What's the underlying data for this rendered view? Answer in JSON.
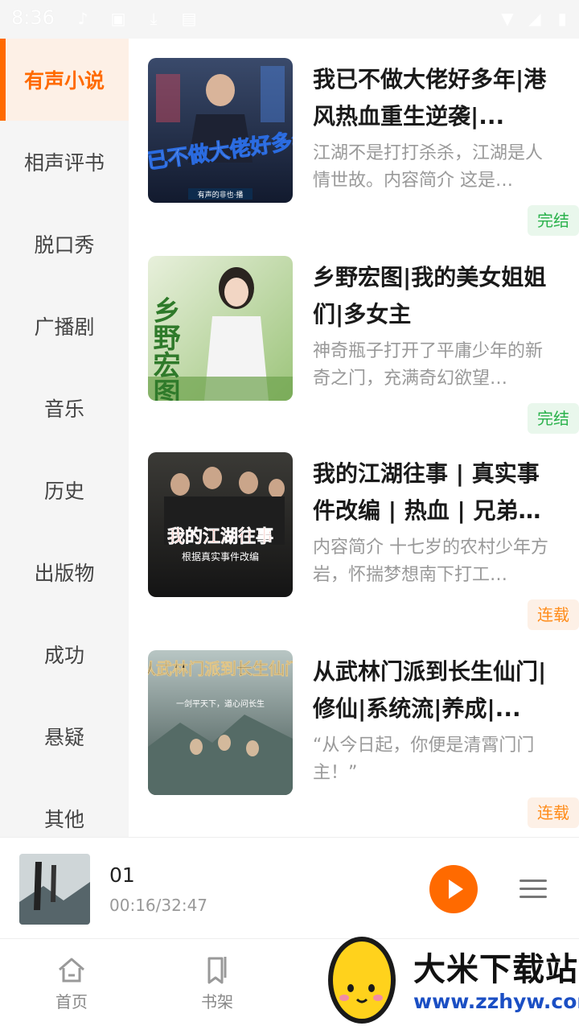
{
  "status_bar": {
    "time": "8:36"
  },
  "sidebar": {
    "categories": [
      "有声小说",
      "相声评书",
      "脱口秀",
      "广播剧",
      "音乐",
      "历史",
      "出版物",
      "成功",
      "悬疑",
      "其他"
    ],
    "active_index": 0
  },
  "books": [
    {
      "title": "我已不做大佬好多年|港风热血重生逆袭|...",
      "description": "江湖不是打打杀杀，江湖是人情世故。内容简介 这是…",
      "status": "完结",
      "cover_text": "我已不做大佬好多年",
      "cover_sub": "有声的非也·播"
    },
    {
      "title": "乡野宏图|我的美女姐姐们|多女主",
      "description": "神奇瓶子打开了平庸少年的新奇之门，充满奇幻欲望…",
      "status": "完结",
      "cover_text": "乡野宏图"
    },
    {
      "title": "我的江湖往事 | 真实事件改编 | 热血 | 兄弟…",
      "description": "内容简介 十七岁的农村少年方岩，怀揣梦想南下打工…",
      "status": "连载",
      "cover_text": "我的江湖往事",
      "cover_sub": "根据真实事件改编"
    },
    {
      "title": "从武林门派到长生仙门|修仙|系统流|养成|...",
      "description": "“从今日起，你便是清霄门门主！”",
      "status": "连载",
      "cover_text": "从武林门派到长生仙门",
      "cover_sub": "一剑平天下，道心问长生"
    }
  ],
  "player": {
    "title": "01",
    "time": "00:16/32:47"
  },
  "tabs": [
    {
      "label": "首页",
      "icon": "home-icon"
    },
    {
      "label": "书架",
      "icon": "bookmark-icon"
    }
  ],
  "watermark": {
    "name": "大米下载站",
    "url": "www.zzhyw.com"
  },
  "colors": {
    "accent": "#ff6a00",
    "done": "#2bb24c",
    "serial": "#ff8c1a"
  }
}
